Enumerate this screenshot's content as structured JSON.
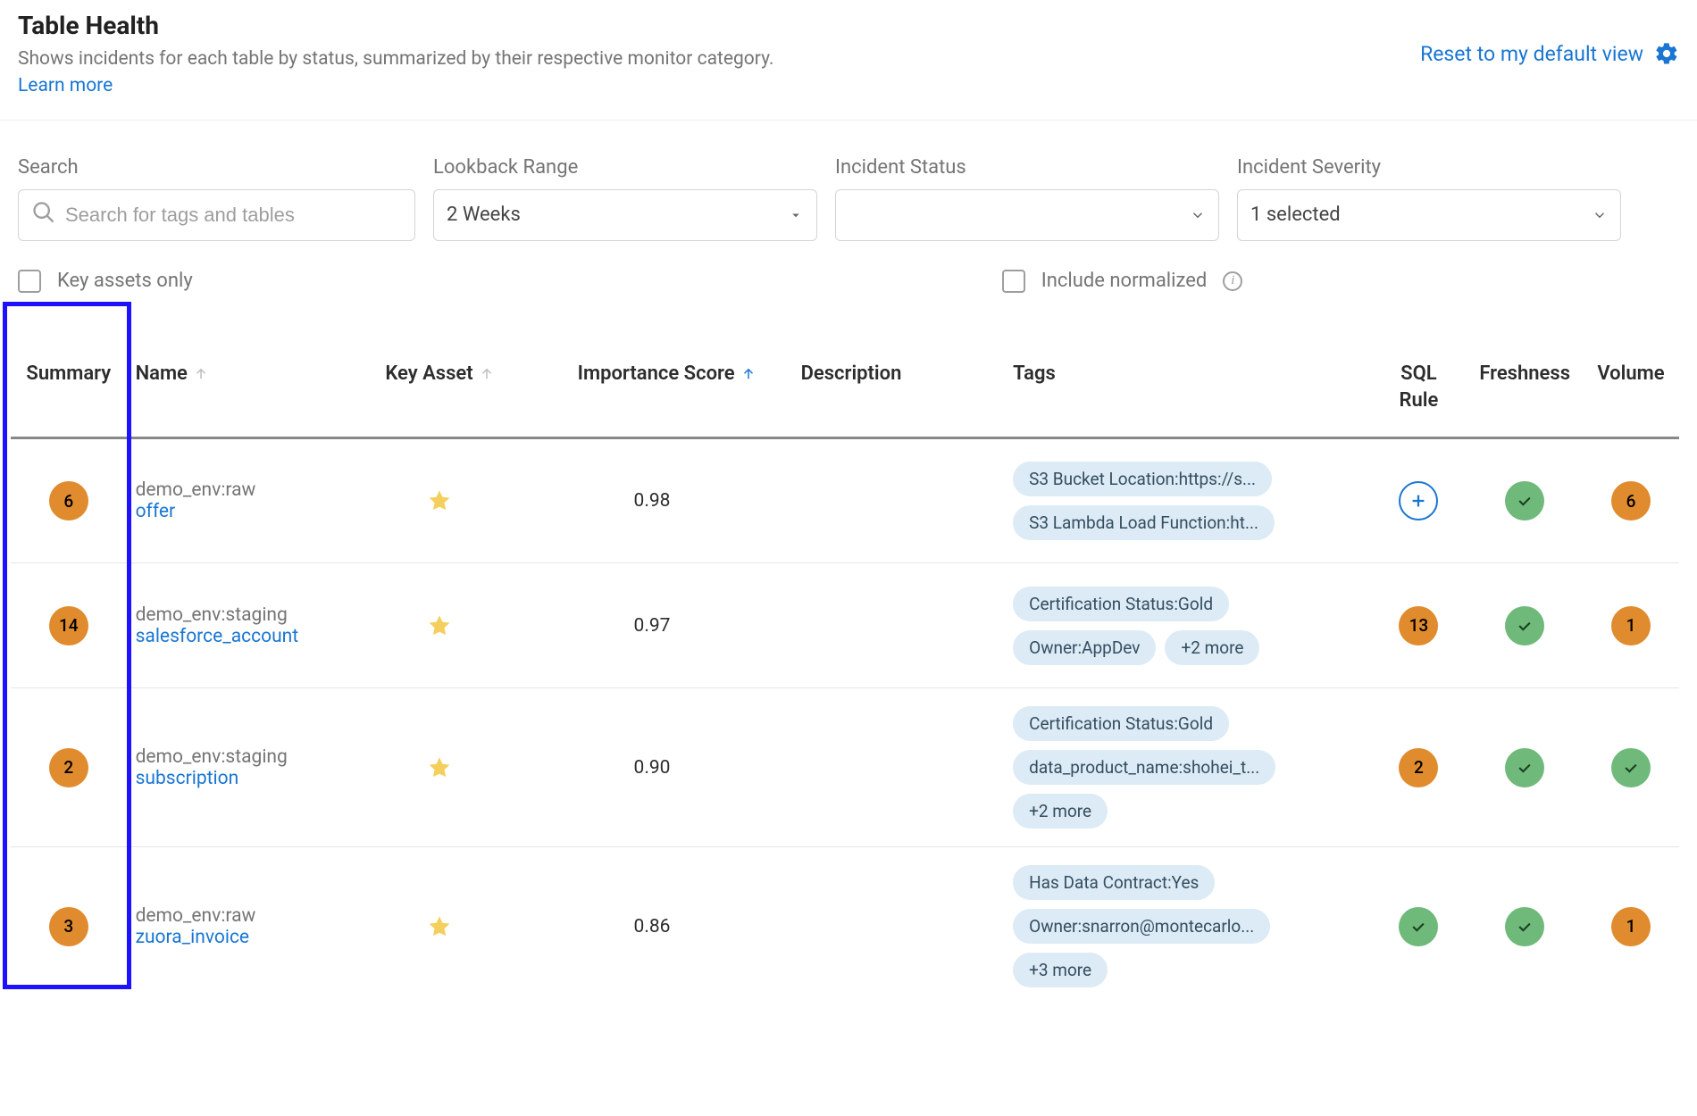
{
  "header": {
    "title": "Table Health",
    "subtitle_prefix": "Shows incidents for each table by status, summarized by their respective monitor category. ",
    "learn_more": "Learn more",
    "reset_link": "Reset to my default view"
  },
  "filters": {
    "search": {
      "label": "Search",
      "placeholder": "Search for tags and tables"
    },
    "lookback": {
      "label": "Lookback Range",
      "value": "2 Weeks"
    },
    "incident_status": {
      "label": "Incident Status",
      "value": ""
    },
    "incident_severity": {
      "label": "Incident Severity",
      "value": "1 selected"
    },
    "key_assets_only": {
      "label": "Key assets only"
    },
    "include_normalized": {
      "label": "Include normalized"
    }
  },
  "table": {
    "columns": {
      "summary": "Summary",
      "name": "Name",
      "key_asset": "Key Asset",
      "importance": "Importance Score",
      "description": "Description",
      "tags": "Tags",
      "sql_rule": "SQL Rule",
      "freshness": "Freshness",
      "volume": "Volume"
    },
    "rows": [
      {
        "summary": "6",
        "env": "demo_env:raw",
        "name": "offer",
        "key_asset": true,
        "score": "0.98",
        "description": "",
        "tags": [
          "S3 Bucket Location:https://s...",
          "S3 Lambda Load Function:ht..."
        ],
        "sql_rule": {
          "type": "plus"
        },
        "freshness": {
          "type": "check"
        },
        "volume": {
          "type": "count",
          "value": "6"
        }
      },
      {
        "summary": "14",
        "env": "demo_env:staging",
        "name": "salesforce_account",
        "key_asset": true,
        "score": "0.97",
        "description": "",
        "tags": [
          "Certification Status:Gold",
          "Owner:AppDev",
          "+2 more"
        ],
        "sql_rule": {
          "type": "count",
          "value": "13"
        },
        "freshness": {
          "type": "check"
        },
        "volume": {
          "type": "count",
          "value": "1"
        }
      },
      {
        "summary": "2",
        "env": "demo_env:staging",
        "name": "subscription",
        "key_asset": true,
        "score": "0.90",
        "description": "",
        "tags": [
          "Certification Status:Gold",
          "data_product_name:shohei_t...",
          "+2 more"
        ],
        "sql_rule": {
          "type": "count",
          "value": "2"
        },
        "freshness": {
          "type": "check"
        },
        "volume": {
          "type": "check"
        }
      },
      {
        "summary": "3",
        "env": "demo_env:raw",
        "name": "zuora_invoice",
        "key_asset": true,
        "score": "0.86",
        "description": "",
        "tags": [
          "Has Data Contract:Yes",
          "Owner:snarron@montecarlo...",
          "+3 more"
        ],
        "sql_rule": {
          "type": "check"
        },
        "freshness": {
          "type": "check"
        },
        "volume": {
          "type": "count",
          "value": "1"
        }
      }
    ]
  },
  "colors": {
    "link": "#1976d2",
    "badge_orange": "#e08b2d",
    "badge_green": "#6fb97a",
    "tag_bg": "#dcebf5",
    "highlight": "#1e11ff"
  }
}
